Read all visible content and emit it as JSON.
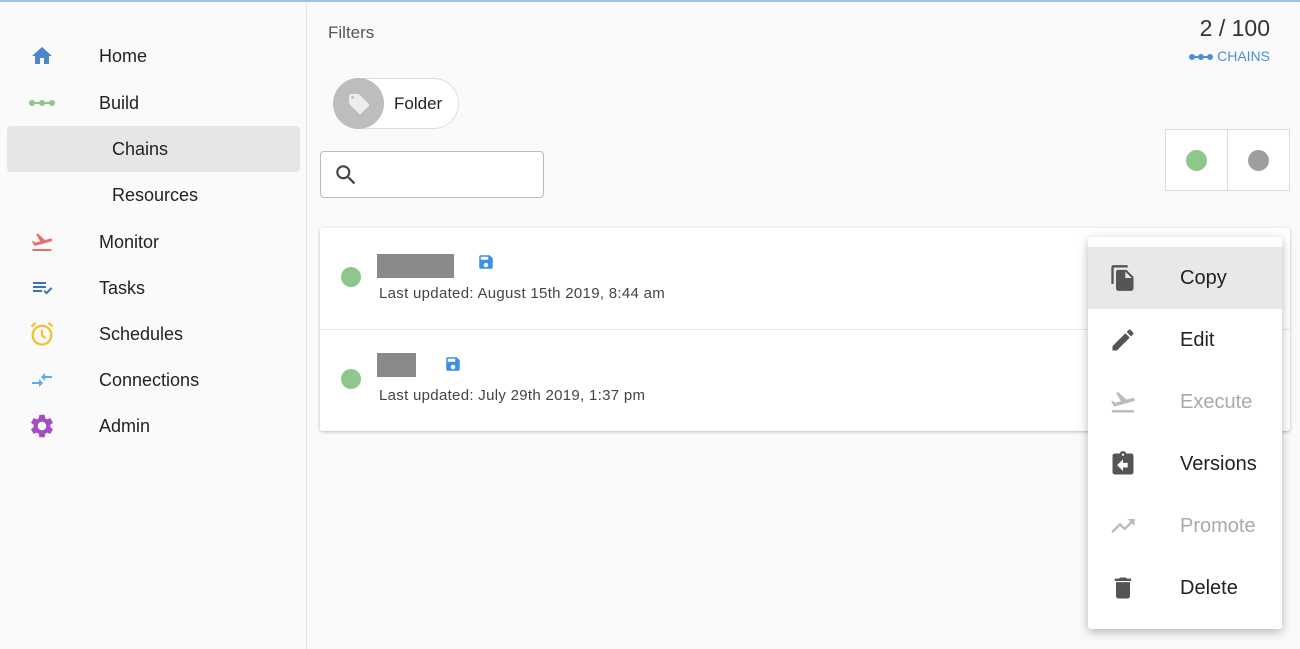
{
  "sidebar": {
    "items": [
      {
        "label": "Home",
        "icon": "home-icon",
        "color": "#4a86c8"
      },
      {
        "label": "Build",
        "icon": "chain-icon",
        "color": "#8ec68c"
      },
      {
        "label": "Chains",
        "sub": true,
        "active": true
      },
      {
        "label": "Resources",
        "sub": true
      },
      {
        "label": "Monitor",
        "icon": "airplane-takeoff-icon",
        "color": "#e5706a"
      },
      {
        "label": "Tasks",
        "icon": "checklist-icon",
        "color": "#3f6fb5"
      },
      {
        "label": "Schedules",
        "icon": "alarm-clock-icon",
        "color": "#f2c230"
      },
      {
        "label": "Connections",
        "icon": "compare-arrows-icon",
        "color": "#5aaee8"
      },
      {
        "label": "Admin",
        "icon": "gear-icon",
        "color": "#a44ec4"
      }
    ]
  },
  "main": {
    "filters_label": "Filters",
    "count": "2 / 100",
    "chains_link": "CHAINS",
    "filter_chip": {
      "label": "Folder",
      "icon": "tag-icon"
    },
    "search": {
      "placeholder": "",
      "value": ""
    },
    "status_toggle": {
      "active_color": "#8ec68c",
      "inactive_color": "#9e9e9e"
    },
    "rows": [
      {
        "updated": "Last updated: August 15th 2019, 8:44 am",
        "status_color": "#8ec68c"
      },
      {
        "updated": "Last updated: July 29th 2019, 1:37 pm",
        "status_color": "#8ec68c"
      }
    ]
  },
  "menu": {
    "items": [
      {
        "label": "Copy",
        "icon": "copy-icon",
        "disabled": false,
        "hover": true
      },
      {
        "label": "Edit",
        "icon": "pencil-icon",
        "disabled": false
      },
      {
        "label": "Execute",
        "icon": "airplane-takeoff-icon",
        "disabled": true
      },
      {
        "label": "Versions",
        "icon": "clipboard-arrow-icon",
        "disabled": false
      },
      {
        "label": "Promote",
        "icon": "trending-up-icon",
        "disabled": true
      },
      {
        "label": "Delete",
        "icon": "trash-icon",
        "disabled": false
      }
    ]
  },
  "colors": {
    "accent": "#4a90d6",
    "save_icon": "#3d8fe8",
    "status_green": "#8ec68c"
  }
}
